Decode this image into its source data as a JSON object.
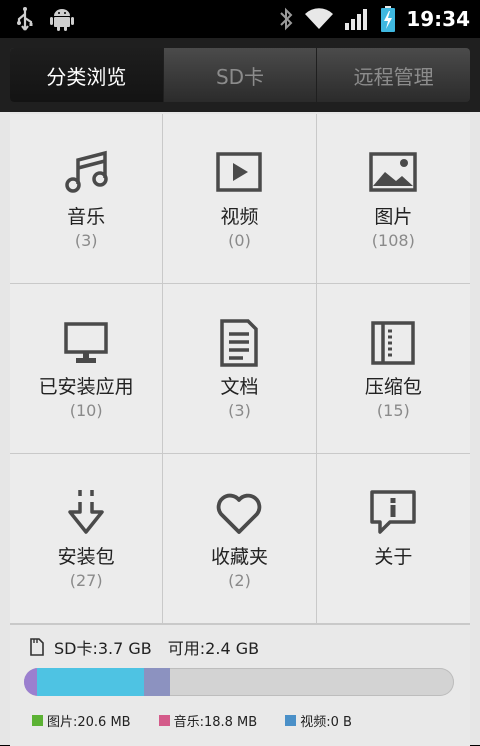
{
  "status_bar": {
    "time": "19:34",
    "icons": [
      "usb-icon",
      "android-icon",
      "bluetooth-icon",
      "wifi-icon",
      "signal-icon",
      "battery-charging-icon"
    ]
  },
  "tabs": [
    {
      "label": "分类浏览",
      "active": true
    },
    {
      "label": "SD卡",
      "active": false
    },
    {
      "label": "远程管理",
      "active": false
    }
  ],
  "categories": [
    {
      "label": "音乐",
      "count": "(3)",
      "icon": "music-note-icon"
    },
    {
      "label": "视频",
      "count": "(0)",
      "icon": "video-play-icon"
    },
    {
      "label": "图片",
      "count": "(108)",
      "icon": "image-icon"
    },
    {
      "label": "已安装应用",
      "count": "(10)",
      "icon": "monitor-icon"
    },
    {
      "label": "文档",
      "count": "(3)",
      "icon": "document-icon"
    },
    {
      "label": "压缩包",
      "count": "(15)",
      "icon": "archive-icon"
    },
    {
      "label": "安装包",
      "count": "(27)",
      "icon": "download-arrow-icon"
    },
    {
      "label": "收藏夹",
      "count": "(2)",
      "icon": "heart-icon"
    },
    {
      "label": "关于",
      "count": "",
      "icon": "info-bubble-icon"
    }
  ],
  "storage": {
    "sd_label": "SD卡:3.7 GB",
    "available_label": "可用:2.4 GB",
    "usage_fractions": {
      "purple": 0.03,
      "blue": 0.25,
      "grey_purple": 0.06
    },
    "legend": [
      {
        "label": "图片:20.6 MB",
        "color": "#5cb234"
      },
      {
        "label": "音乐:18.8 MB",
        "color": "#d45b8a"
      },
      {
        "label": "视频:0 B",
        "color": "#4a90c8"
      }
    ]
  },
  "colors": {
    "purple": "#9b7fcf",
    "blue": "#4ec3e3",
    "grey_purple": "#8c92c0",
    "orange": "#e8883a",
    "violet": "#8e6ad0",
    "yellow": "#e3c248"
  }
}
